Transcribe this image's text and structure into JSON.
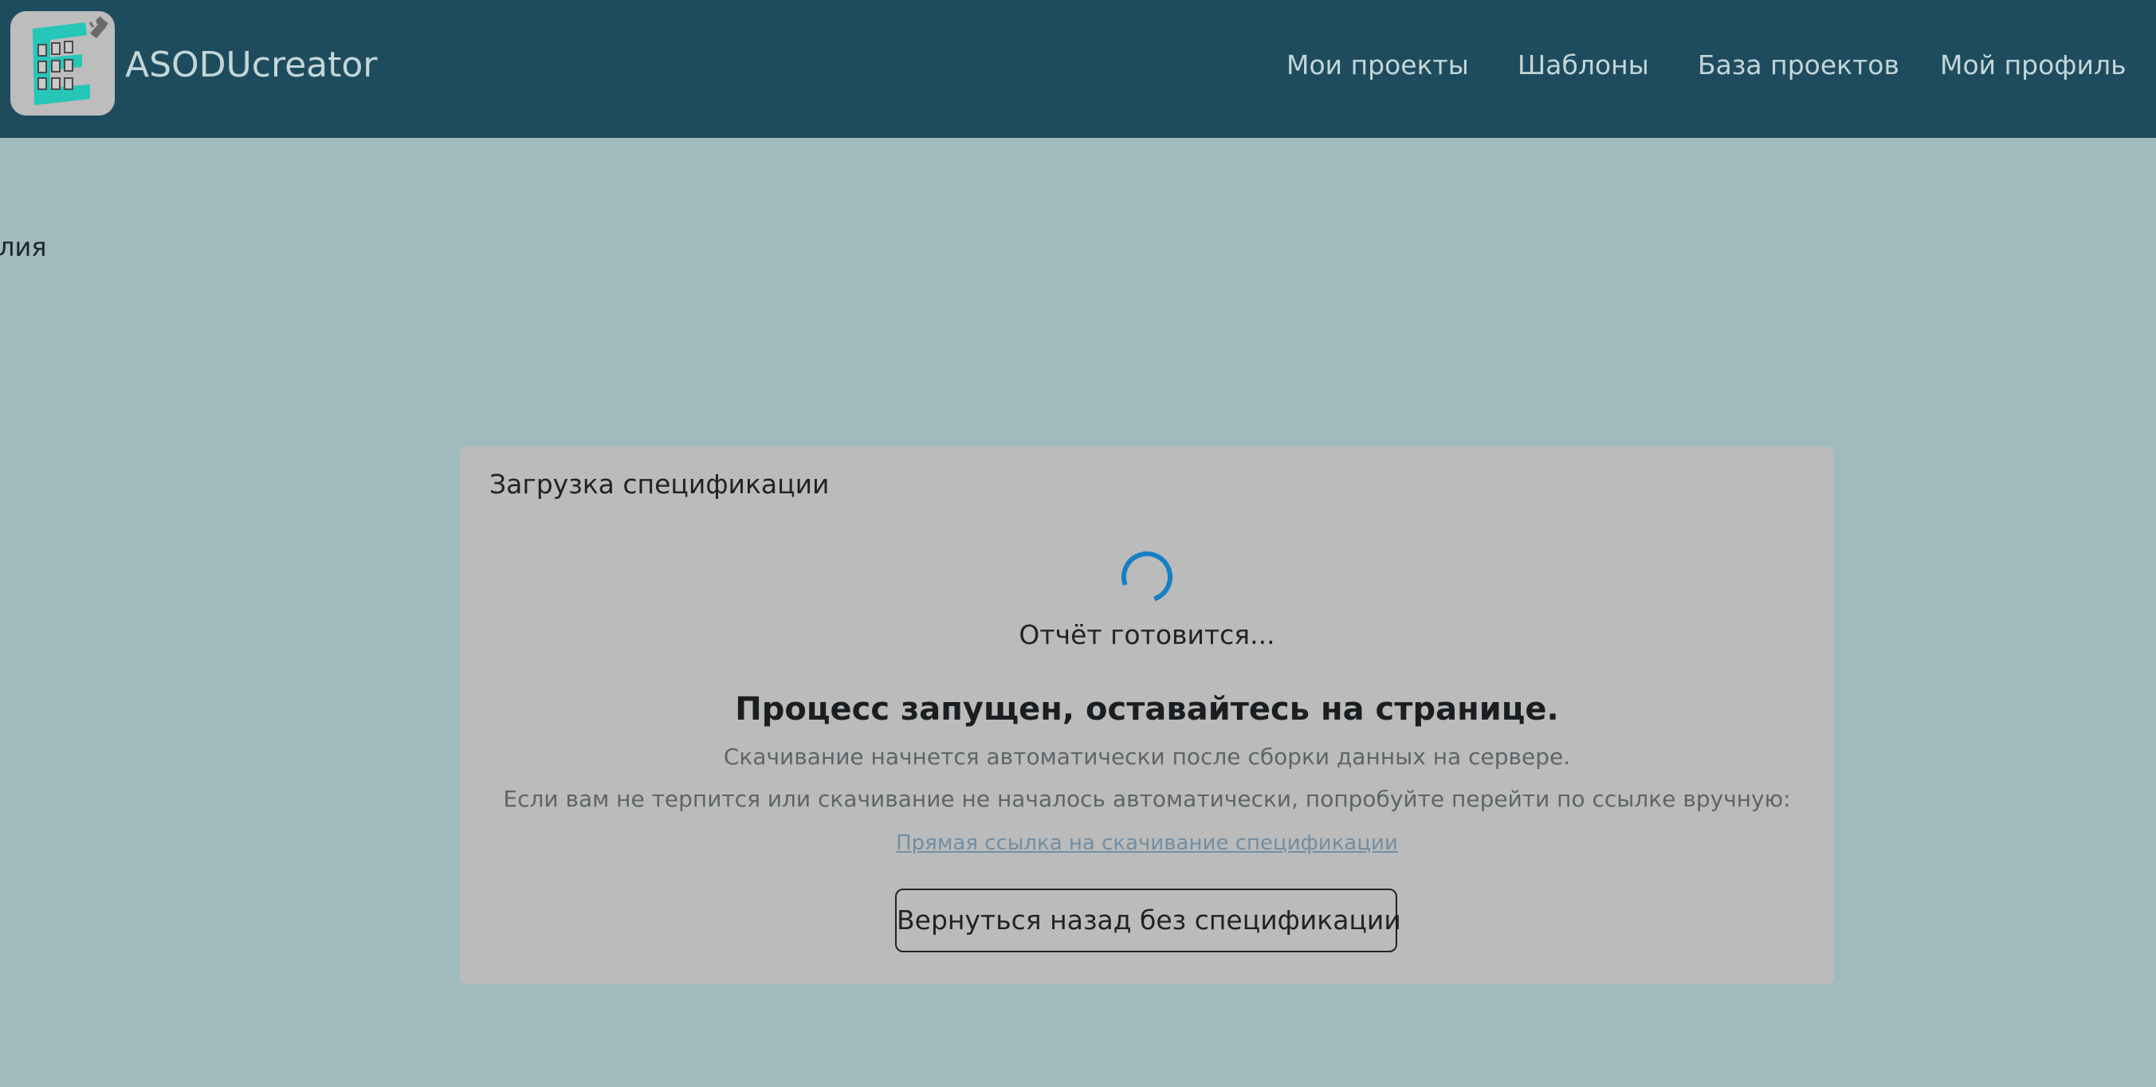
{
  "app": {
    "brand": "ASODUcreator",
    "logo_icon": "building-with-hammer-icon"
  },
  "nav": {
    "items": [
      {
        "label": "Мои проекты"
      },
      {
        "label": "Шаблоны"
      },
      {
        "label": "База проектов"
      },
      {
        "label": "Мой профиль"
      }
    ]
  },
  "background": {
    "text_fragment": "лия"
  },
  "modal": {
    "title": "Загрузка спецификации",
    "spinner_icon": "loading-spinner-icon",
    "status": "Отчёт готовится...",
    "headline": "Процесс запущен, оставайтесь на странице.",
    "description_1": "Скачивание начнется автоматически после сборки данных на сервере.",
    "description_2": "Если вам не терпится или скачивание не началось автоматически, попробуйте перейти по ссылке вручную:",
    "direct_link": "Прямая ссылка на скачивание спецификации",
    "back_button": "Вернуться назад без спецификации"
  },
  "colors": {
    "navbar": "#1e4c5e",
    "page_background": "#a1babd",
    "modal_background": "#bbbbbb",
    "spinner": "#1581c4",
    "logo_accent": "#26c6b8",
    "link": "#728ea4"
  }
}
